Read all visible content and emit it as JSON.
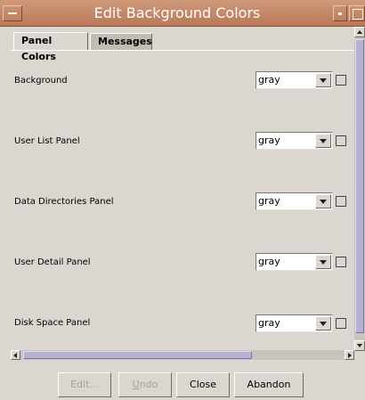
{
  "window": {
    "title": "Edit Background Colors"
  },
  "tabs": [
    {
      "label": "Panel Colors",
      "active": true
    },
    {
      "label": "Messages",
      "active": false
    }
  ],
  "rows": [
    {
      "label": "Background",
      "value": "gray"
    },
    {
      "label": "User List Panel",
      "value": "gray"
    },
    {
      "label": "Data Directories Panel",
      "value": "gray"
    },
    {
      "label": "User Detail Panel",
      "value": "gray"
    },
    {
      "label": "Disk Space Panel",
      "value": "gray"
    }
  ],
  "buttons": {
    "edit": "Edit...",
    "undo_mnemonic": "U",
    "undo_rest": "ndo",
    "close": "Close",
    "abandon": "Abandon"
  },
  "colors": {
    "titlebar": "#c08060",
    "window_bg": "#dcd6d0",
    "scroll_thumb": "#b7b1d6"
  }
}
